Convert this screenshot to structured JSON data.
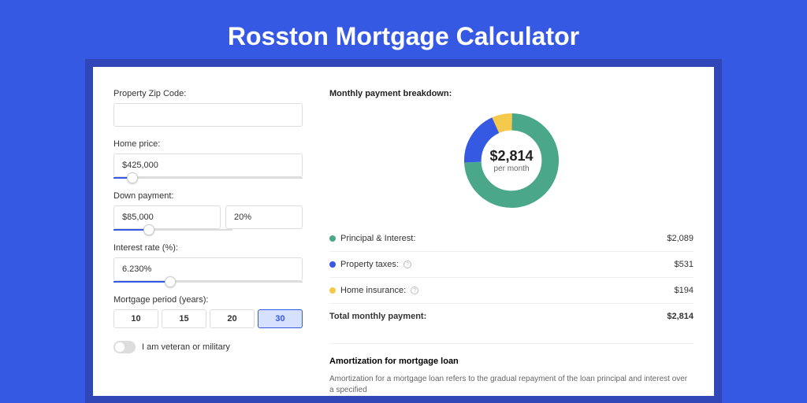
{
  "title": "Rosston Mortgage Calculator",
  "left": {
    "zip": {
      "label": "Property Zip Code:",
      "value": ""
    },
    "price": {
      "label": "Home price:",
      "value": "$425,000",
      "slider_pct": 10
    },
    "down": {
      "label": "Down payment:",
      "value": "$85,000",
      "pct": "20%",
      "slider_pct": 20
    },
    "rate": {
      "label": "Interest rate (%):",
      "value": "6.230%",
      "slider_pct": 30
    },
    "period": {
      "label": "Mortgage period (years):",
      "options": [
        "10",
        "15",
        "20",
        "30"
      ],
      "selected": "30"
    },
    "veteran": {
      "label": "I am veteran or military"
    }
  },
  "right": {
    "breakdown_title": "Monthly payment breakdown:",
    "donut": {
      "amount": "$2,814",
      "sub": "per month"
    },
    "rows": [
      {
        "color": "green",
        "label": "Principal & Interest:",
        "value": "$2,089",
        "info": false
      },
      {
        "color": "blue",
        "label": "Property taxes:",
        "value": "$531",
        "info": true
      },
      {
        "color": "yellow",
        "label": "Home insurance:",
        "value": "$194",
        "info": true
      }
    ],
    "total": {
      "label": "Total monthly payment:",
      "value": "$2,814"
    },
    "amort": {
      "title": "Amortization for mortgage loan",
      "text": "Amortization for a mortgage loan refers to the gradual repayment of the loan principal and interest over a specified"
    }
  },
  "chart_data": {
    "type": "pie",
    "title": "Monthly payment breakdown",
    "values": [
      2089,
      531,
      194
    ],
    "categories": [
      "Principal & Interest",
      "Property taxes",
      "Home insurance"
    ],
    "colors": [
      "#4aa789",
      "#3659e3",
      "#f5c94b"
    ],
    "total": 2814
  }
}
